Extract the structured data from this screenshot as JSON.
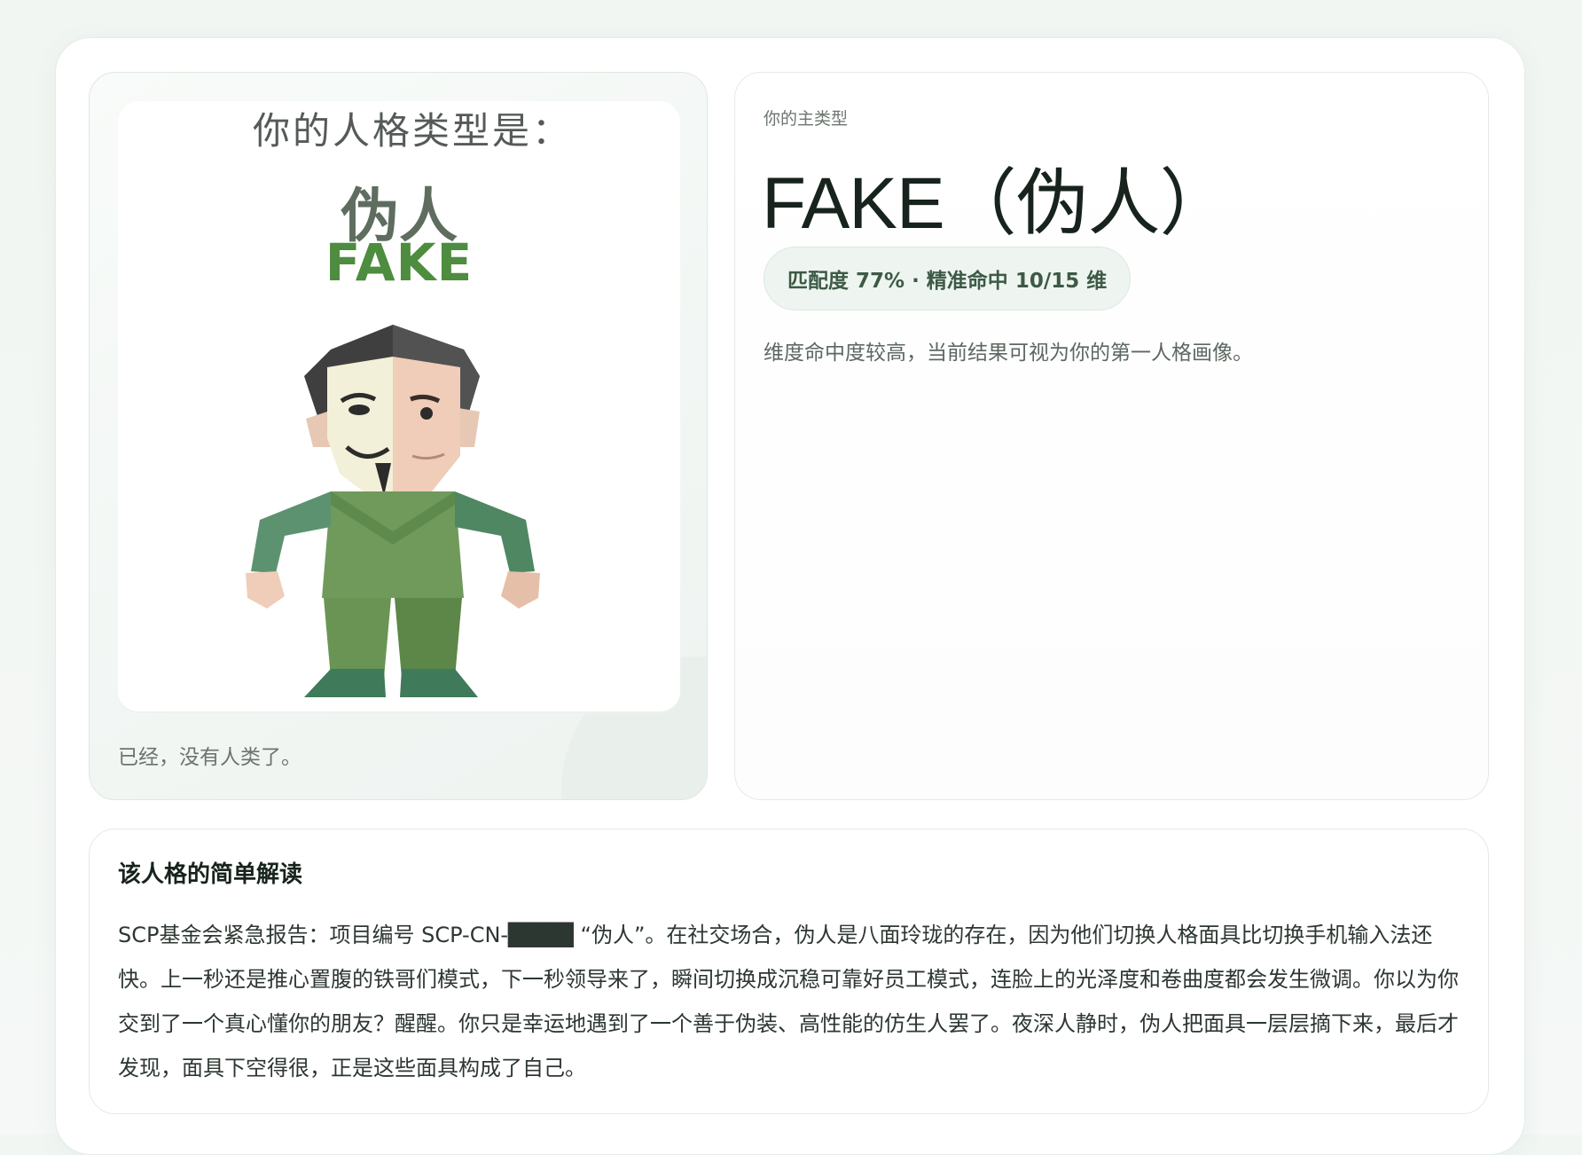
{
  "poster": {
    "watermark": "",
    "heading": "你的人格类型是：",
    "type_cn": "伪人",
    "type_en": "FAKE",
    "caption": "已经，没有人类了。"
  },
  "result": {
    "eyebrow": "你的主类型",
    "title": "FAKE（伪人）",
    "match_badge": "匹配度 77% · 精准命中 10/15 维",
    "description": "维度命中度较高，当前结果可视为你的第一人格画像。"
  },
  "reading": {
    "title": "该人格的简单解读",
    "body": "SCP基金会紧急报告：项目编号 SCP-CN-████ “伪人”。在社交场合，伪人是八面玲珑的存在，因为他们切换人格面具比切换手机输入法还快。上一秒还是推心置腹的铁哥们模式，下一秒领导来了，瞬间切换成沉稳可靠好员工模式，连脸上的光泽度和卷曲度都会发生微调。你以为你交到了一个真心懂你的朋友？醒醒。你只是幸运地遇到了一个善于伪装、高性能的仿生人罢了。夜深人静时，伪人把面具一层层摘下来，最后才发现，面具下空得很，正是这些面具构成了自己。"
  },
  "colors": {
    "accent_green": "#4e8c3f",
    "figure_green": "#6f9a5b",
    "pill_bg": "#eef5f0",
    "text_dark": "#17231c"
  },
  "icons": {
    "poster_figure": "masked-figure-illustration"
  }
}
